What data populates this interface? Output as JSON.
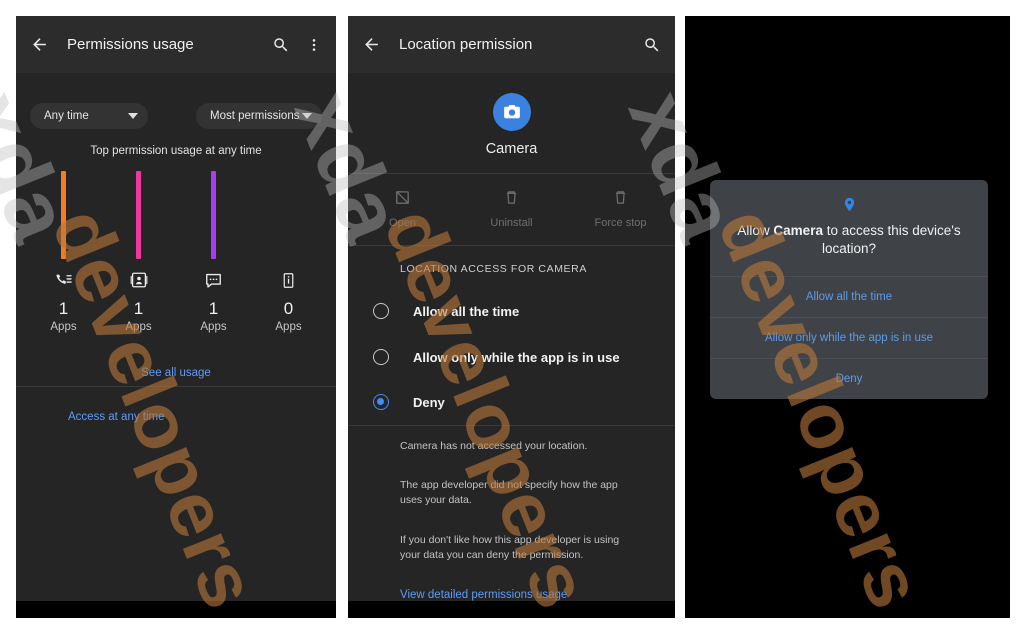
{
  "watermark": {
    "text_part1": "xda",
    "text_part2": "developers",
    "color1": "#bebebe",
    "color2": "#ba783a"
  },
  "colors": {
    "accent_blue": "#5d9cf8",
    "radio_blue": "#3d8ef5",
    "bar_orange": "#f57c20",
    "bar_pink": "#f0369f",
    "bar_purple": "#a83df5",
    "appbar_bg": "#2c2c2c",
    "panel_bg": "#252525",
    "dialog_bg": "#3f4347"
  },
  "panel1": {
    "appbar": {
      "title": "Permissions usage",
      "back_icon": "back-arrow-icon",
      "search_icon": "search-icon",
      "overflow_icon": "more-vert-icon"
    },
    "filters": {
      "time_chip": {
        "label": "Any time",
        "caret": "chevron-down-icon"
      },
      "sort_chip": {
        "label": "Most permissions",
        "caret": "chevron-down-icon"
      }
    },
    "chart_title": "Top permission usage at any time",
    "see_all_label": "See all usage",
    "access_link_label": "Access at any time",
    "chart_data": {
      "type": "bar",
      "title": "Top permission usage at any time",
      "categories": [
        "Phone",
        "Contacts",
        "SMS",
        "Device"
      ],
      "icons": [
        "call-log-icon",
        "contacts-icon",
        "sms-icon",
        "device-info-icon"
      ],
      "values": [
        1,
        1,
        1,
        0
      ],
      "value_labels": [
        "1",
        "1",
        "1",
        "0"
      ],
      "unit_label": "Apps",
      "bar_colors": [
        "#f57c20",
        "#f0369f",
        "#a83df5",
        "#00000000"
      ],
      "xlabel": "",
      "ylabel": "Apps",
      "ylim": [
        0,
        1
      ],
      "grid": false,
      "legend": "none"
    }
  },
  "panel2": {
    "appbar": {
      "title": "Location permission",
      "back_icon": "back-arrow-icon",
      "search_icon": "search-icon"
    },
    "app": {
      "name": "Camera",
      "icon": "camera-app-icon"
    },
    "actions": [
      {
        "label": "Open",
        "icon": "open-external-icon",
        "enabled": false
      },
      {
        "label": "Uninstall",
        "icon": "trash-icon",
        "enabled": false
      },
      {
        "label": "Force stop",
        "icon": "trash-icon",
        "enabled": false
      }
    ],
    "section_header": "LOCATION ACCESS FOR CAMERA",
    "options": [
      {
        "label": "Allow all the time",
        "selected": false
      },
      {
        "label": "Allow only while the app is in use",
        "selected": false
      },
      {
        "label": "Deny",
        "selected": true
      }
    ],
    "paragraphs": [
      "Camera has not accessed your location.",
      "The app developer did not specify how the app uses your data.",
      "If you don't like how this app developer is using your data you can deny the permission."
    ],
    "detail_link_label": "View detailed permissions usage"
  },
  "panel3": {
    "dialog": {
      "icon": "location-pin-icon",
      "text_before": "Allow ",
      "app_name": "Camera",
      "text_after": " to access this device's location?",
      "buttons": [
        {
          "label": "Allow all the time"
        },
        {
          "label": "Allow only while the app is in use"
        },
        {
          "label": "Deny"
        }
      ]
    }
  }
}
